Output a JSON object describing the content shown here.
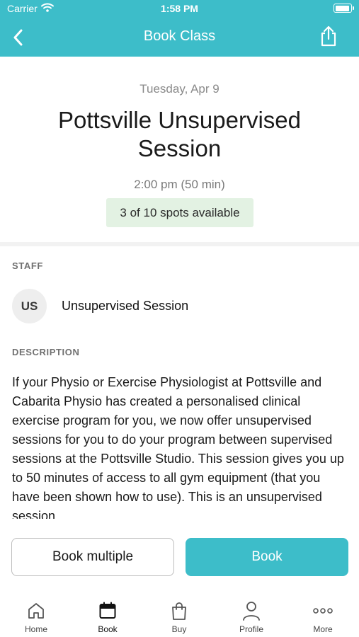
{
  "status_bar": {
    "carrier": "Carrier",
    "time": "1:58 PM"
  },
  "nav": {
    "title": "Book Class",
    "back_icon": "chevron-left-icon",
    "share_icon": "share-icon"
  },
  "session": {
    "date": "Tuesday, Apr 9",
    "title": "Pottsville Unsupervised Session",
    "time": "2:00 pm (50 min)",
    "spots": "3 of 10 spots available"
  },
  "staff": {
    "label": "STAFF",
    "initials": "US",
    "name": "Unsupervised Session"
  },
  "description": {
    "label": "DESCRIPTION",
    "text": "If your Physio or Exercise Physiologist at Pottsville and Cabarita Physio has created a personalised clinical exercise program for you, we now offer unsupervised sessions for you to do your program between supervised sessions at the Pottsville Studio. This session gives you up to 50 minutes of access to all gym equipment (that you have been shown how to use). This is an unsupervised session"
  },
  "actions": {
    "book_multiple": "Book multiple",
    "book": "Book"
  },
  "colors": {
    "accent": "#3dbdc9",
    "spots_bg": "#e3f2e3"
  },
  "tabs": [
    {
      "label": "Home",
      "icon": "home-icon",
      "active": false
    },
    {
      "label": "Book",
      "icon": "calendar-icon",
      "active": true
    },
    {
      "label": "Buy",
      "icon": "shopping-bag-icon",
      "active": false
    },
    {
      "label": "Profile",
      "icon": "person-icon",
      "active": false
    },
    {
      "label": "More",
      "icon": "more-icon",
      "active": false
    }
  ]
}
